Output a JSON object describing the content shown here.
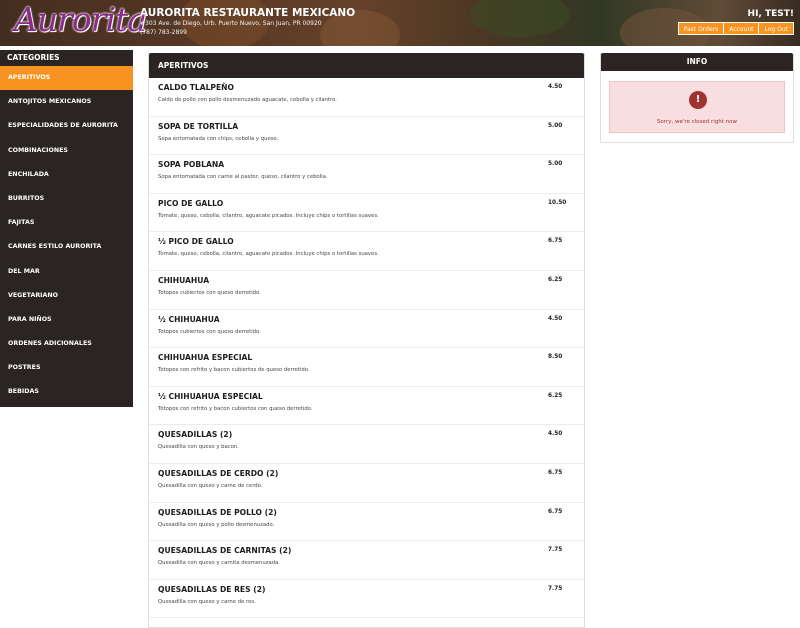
{
  "header": {
    "logo_text": "Aurorita",
    "restaurant_name": "AURORITA RESTAURANTE MEXICANO",
    "address": "#303 Ave. de Diego, Urb. Puerto Nuevo, San Juan, PR 00920",
    "phone": "(787) 783-2899",
    "greeting": "HI, TEST!",
    "buttons": {
      "past_orders": "Past Orders",
      "account": "Account",
      "logout": "Log Out"
    }
  },
  "sidebar": {
    "title": "CATEGORIES",
    "items": [
      {
        "label": "APERITIVOS"
      },
      {
        "label": "ANTOJITOS MEXICANOS"
      },
      {
        "label": "ESPECIALIDADES DE AURORITA"
      },
      {
        "label": "COMBINACIONES"
      },
      {
        "label": "ENCHILADA"
      },
      {
        "label": "BURRITOS"
      },
      {
        "label": "FAJITAS"
      },
      {
        "label": "CARNES ESTILO AURORITA"
      },
      {
        "label": "DEL MAR"
      },
      {
        "label": "VEGETARIANO"
      },
      {
        "label": "PARA NIÑOS"
      },
      {
        "label": "ORDENES ADICIONALES"
      },
      {
        "label": "POSTRES"
      },
      {
        "label": "BEBIDAS"
      }
    ]
  },
  "menu": {
    "title": "APERITIVOS",
    "items": [
      {
        "name": "CALDO TLALPEÑO",
        "desc": "Caldo de pollo con pollo desmenuzado aguacate, cebolla y cilantro.",
        "price": "4.50"
      },
      {
        "name": "SOPA DE TORTILLA",
        "desc": "Sopa entomatada con chips, cebolla y queso.",
        "price": "5.00"
      },
      {
        "name": "SOPA POBLANA",
        "desc": "Sopa entomatada con carne al pastor, queso, cilantro y cebolla.",
        "price": "5.00"
      },
      {
        "name": "PICO DE GALLO",
        "desc": "Tomate, queso, cebolla, cilantro, aguacate picados. Incluye chips o tortillas suaves.",
        "price": "10.50"
      },
      {
        "name": "½ PICO DE GALLO",
        "desc": "Tomate, queso, cebolla, cilantro, aguacate picados. Incluye chips o tortillas suaves.",
        "price": "6.75"
      },
      {
        "name": "CHIHUAHUA",
        "desc": "Totopos cubiertos con queso derretido.",
        "price": "6.25"
      },
      {
        "name": "½ CHIHUAHUA",
        "desc": "Totopos cubiertos con queso derretido.",
        "price": "4.50"
      },
      {
        "name": "CHIHUAHUA ESPECIAL",
        "desc": "Totopos con refrito y bacon cubiertos de queso derretido.",
        "price": "8.50"
      },
      {
        "name": "½ CHIHUAHUA ESPECIAL",
        "desc": "Totopos con refrito y bacon cubiertos con queso derretido.",
        "price": "6.25"
      },
      {
        "name": "QUESADILLAS (2)",
        "desc": "Quesadilla con queso y bacon.",
        "price": "4.50"
      },
      {
        "name": "QUESADILLAS DE CERDO (2)",
        "desc": "Quesadilla con queso y carne de cerdo.",
        "price": "6.75"
      },
      {
        "name": "QUESADILLAS DE POLLO (2)",
        "desc": "Quesadilla con queso y pollo desmenuzado.",
        "price": "6.75"
      },
      {
        "name": "QUESADILLAS DE CARNITAS (2)",
        "desc": "Quesadilla con queso y carnita desmenuzada.",
        "price": "7.75"
      },
      {
        "name": "QUESADILLAS DE RES (2)",
        "desc": "Quesadilla con queso y carne de res.",
        "price": "7.75"
      }
    ]
  },
  "info": {
    "title": "INFO",
    "icon": "alert-circle-icon",
    "message": "Sorry, we're closed right now"
  },
  "colors": {
    "accent": "#f7931e",
    "dark": "#2a2422",
    "alert_bg": "#f8dede",
    "alert_text": "#9e3333",
    "logo": "#8a2a8a"
  }
}
